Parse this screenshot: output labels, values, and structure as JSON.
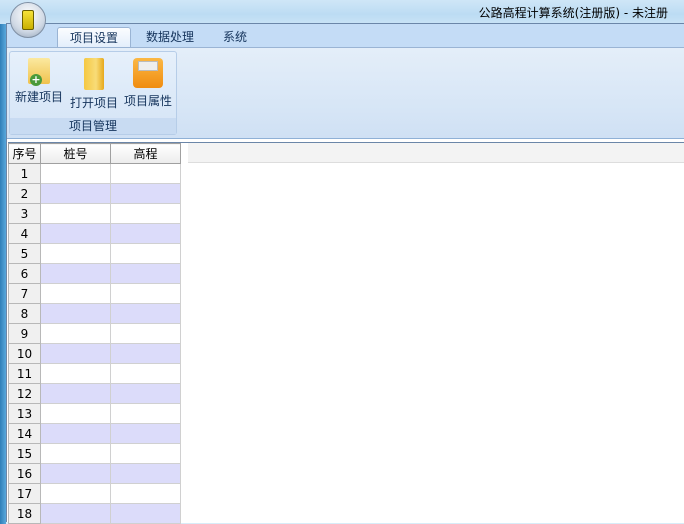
{
  "window": {
    "title": "公路高程计算系统(注册版) - 未注册"
  },
  "tabs": [
    {
      "label": "项目设置",
      "active": true
    },
    {
      "label": "数据处理"
    },
    {
      "label": "系统"
    }
  ],
  "ribbon": {
    "group_label": "项目管理",
    "buttons": [
      {
        "label": "新建项目",
        "icon": "new-project-icon"
      },
      {
        "label": "打开项目",
        "icon": "open-folder-icon"
      },
      {
        "label": "项目属性",
        "icon": "properties-icon"
      }
    ]
  },
  "grid": {
    "columns": [
      "序号",
      "桩号",
      "高程"
    ],
    "rows": [
      "1",
      "2",
      "3",
      "4",
      "5",
      "6",
      "7",
      "8",
      "9",
      "10",
      "11",
      "12",
      "13",
      "14",
      "15",
      "16",
      "17",
      "18"
    ]
  },
  "colors": {
    "even_row": "#dcdcfa",
    "ribbon": "#d6e5f6"
  }
}
